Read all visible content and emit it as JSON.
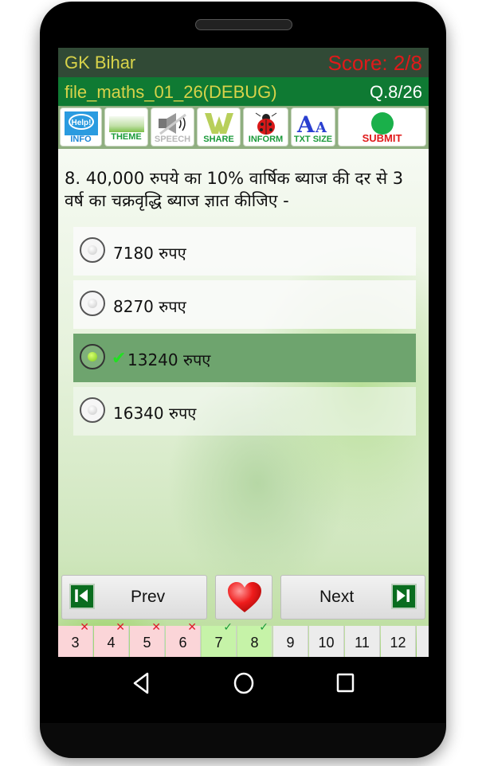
{
  "app": {
    "title": "GK Bihar",
    "score": "Score: 2/8",
    "file": "file_maths_01_26(DEBUG)",
    "question_counter": "Q.8/26"
  },
  "toolbar": [
    {
      "label": "INFO",
      "icon": "help-bubble-icon",
      "color": "#1a86d8"
    },
    {
      "label": "THEME",
      "icon": "theme-image-icon",
      "color": "#1a9a3a"
    },
    {
      "label": "SPEECH",
      "icon": "speaker-muted-icon",
      "color": "#b8b8b8"
    },
    {
      "label": "SHARE",
      "icon": "share-w-icon",
      "color": "#1a9a3a"
    },
    {
      "label": "INFORM",
      "icon": "ladybug-icon",
      "color": "#1a9a3a"
    },
    {
      "label": "TXT SIZE",
      "icon": "text-size-icon",
      "color": "#1a9a3a"
    },
    {
      "label": "SUBMIT",
      "icon": "green-dot-icon",
      "color": "#e01a1a"
    }
  ],
  "question": {
    "text": "8. 40,000 रुपये का 10% वार्षिक ब्याज की दर से 3 वर्ष का चक्रवृद्धि ब्याज ज्ञात कीजिए -",
    "options": [
      {
        "text": "7180 रुपए",
        "selected": false
      },
      {
        "text": "8270 रुपए",
        "selected": false
      },
      {
        "text": "13240 रुपए",
        "selected": true,
        "correct_mark": "✔"
      },
      {
        "text": "16340 रुपए",
        "selected": false
      }
    ]
  },
  "nav": {
    "prev_label": "Prev",
    "next_label": "Next",
    "favorite_icon": "heart-icon"
  },
  "question_strip": [
    {
      "n": "3",
      "status": "wrong",
      "mark": "✕"
    },
    {
      "n": "4",
      "status": "wrong",
      "mark": "✕"
    },
    {
      "n": "5",
      "status": "wrong",
      "mark": "✕"
    },
    {
      "n": "6",
      "status": "wrong",
      "mark": "✕"
    },
    {
      "n": "7",
      "status": "correct",
      "mark": "✓"
    },
    {
      "n": "8",
      "status": "correct",
      "mark": "✓"
    },
    {
      "n": "9",
      "status": "unanswered",
      "mark": ""
    },
    {
      "n": "10",
      "status": "unanswered",
      "mark": ""
    },
    {
      "n": "11",
      "status": "unanswered",
      "mark": ""
    },
    {
      "n": "12",
      "status": "unanswered",
      "mark": ""
    }
  ],
  "colors": {
    "titlebar": "#314a36",
    "subbar": "#0f7a33",
    "title_text": "#d8d34a",
    "score_text": "#e01a1a",
    "selected_option": "#6ea46e",
    "wrong_cell": "#fbd5d8",
    "correct_cell": "#c6f3a8",
    "unanswered_cell": "#ececec"
  }
}
